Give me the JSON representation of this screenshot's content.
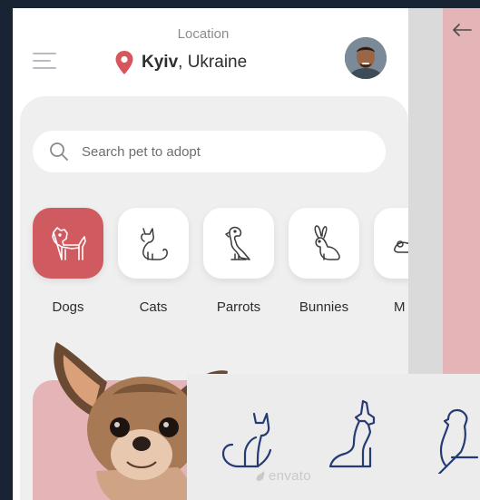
{
  "header": {
    "location_caption": "Location",
    "city": "Kyiv",
    "country": ", Ukraine"
  },
  "search": {
    "placeholder": "Search pet to adopt"
  },
  "categories": [
    {
      "label": "Dogs",
      "icon": "dog-icon",
      "active": true
    },
    {
      "label": "Cats",
      "icon": "cat-icon",
      "active": false
    },
    {
      "label": "Parrots",
      "icon": "parrot-icon",
      "active": false
    },
    {
      "label": "Bunnies",
      "icon": "bunny-icon",
      "active": false
    },
    {
      "label": "M",
      "icon": "mouse-icon",
      "active": false
    }
  ],
  "overlay": {
    "watermark": "envato",
    "icons": [
      "cat-outline-icon",
      "dog-outline-icon",
      "parrot-outline-icon"
    ]
  },
  "colors": {
    "accent": "#cf5b60",
    "card_pink": "#e4b4b6",
    "background": "#182433",
    "panel_grey": "#efefef",
    "icon_navy": "#243b73"
  }
}
